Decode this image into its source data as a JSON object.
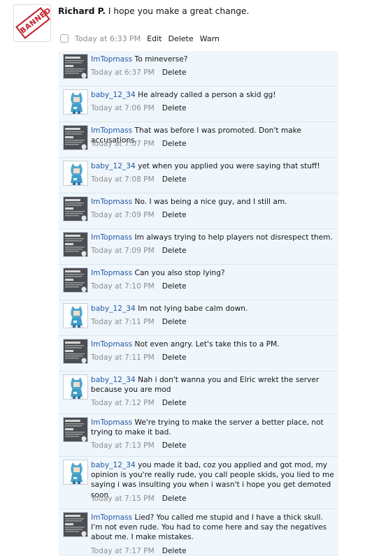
{
  "post": {
    "author": "Richard P.",
    "message": "I hope you make a great change.",
    "avatar_stamp": "BANNED",
    "time": "Today at 6:33 PM",
    "edit_label": "Edit",
    "delete_label": "Delete",
    "warn_label": "Warn"
  },
  "comments": [
    {
      "user": "ImTopmass",
      "avatar": "darkness",
      "text": "To mineverse?",
      "time": "Today at 6:37 PM",
      "delete": "Delete"
    },
    {
      "user": "baby_12_34",
      "avatar": "character",
      "text": "He already called a person a skid gg!",
      "time": "Today at 7:06 PM",
      "delete": "Delete"
    },
    {
      "user": "ImTopmass",
      "avatar": "darkness",
      "text": "That was before I was promoted. Don't make accusations.",
      "time": "Today at 7:07 PM",
      "delete": "Delete"
    },
    {
      "user": "baby_12_34",
      "avatar": "character",
      "text": "yet when you applied you were saying that stuff!",
      "time": "Today at 7:08 PM",
      "delete": "Delete"
    },
    {
      "user": "ImTopmass",
      "avatar": "darkness",
      "text": "No. I was being a nice guy, and I still am.",
      "time": "Today at 7:09 PM",
      "delete": "Delete"
    },
    {
      "user": "ImTopmass",
      "avatar": "darkness",
      "text": "Im always trying to help players not disrespect them.",
      "time": "Today at 7:09 PM",
      "delete": "Delete"
    },
    {
      "user": "ImTopmass",
      "avatar": "darkness",
      "text": "Can you also stop lying?",
      "time": "Today at 7:10 PM",
      "delete": "Delete"
    },
    {
      "user": "baby_12_34",
      "avatar": "character",
      "text": "Im not lying babe calm down.",
      "time": "Today at 7:11 PM",
      "delete": "Delete"
    },
    {
      "user": "ImTopmass",
      "avatar": "darkness",
      "text": "Not even angry. Let's take this to a PM.",
      "time": "Today at 7:11 PM",
      "delete": "Delete"
    },
    {
      "user": "baby_12_34",
      "avatar": "character",
      "text": "Nah i don't wanna you and Elric wrekt the server because you are mod",
      "time": "Today at 7:12 PM",
      "delete": "Delete"
    },
    {
      "user": "ImTopmass",
      "avatar": "darkness",
      "text": "We're trying to make the server a better place, not trying to make it bad.",
      "time": "Today at 7:13 PM",
      "delete": "Delete"
    },
    {
      "user": "baby_12_34",
      "avatar": "character",
      "text": "you made it bad, coz you applied and got mod, my opinion is you're really rude, you call people skids, you lied to me saying i was insulting you when i wasn't i hope you get demoted soon",
      "time": "Today at 7:15 PM",
      "delete": "Delete"
    },
    {
      "user": "ImTopmass",
      "avatar": "darkness",
      "text": "Lied? You called me stupid and I have a thick skull. I'm not even rude. You had to come here and say the negatives about me. I make mistakes.",
      "time": "Today at 7:17 PM",
      "delete": "Delete"
    }
  ]
}
